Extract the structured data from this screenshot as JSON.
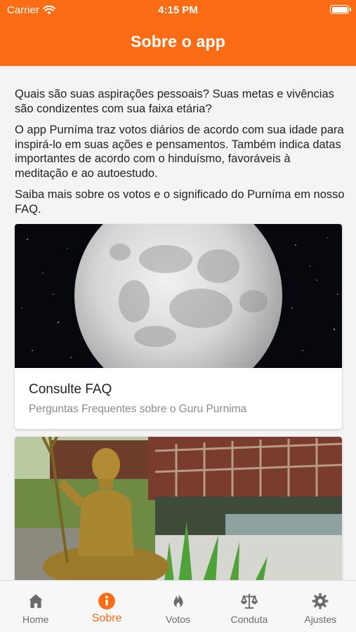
{
  "status_bar": {
    "carrier": "Carrier",
    "time": "4:15 PM"
  },
  "header": {
    "title": "Sobre o app"
  },
  "intro": {
    "p1": "Quais são suas aspirações pessoais? Suas metas e vivências são condizentes com sua faixa etária?",
    "p2": "O app Purníma traz votos diários de acordo com sua idade para inspirá-lo em suas ações e pensamentos. Também indica datas importantes de acordo com o hinduísmo, favoráveis à meditação e ao autoestudo.",
    "p3": "Saiba mais sobre os votos e o significado do Purníma em nosso FAQ."
  },
  "cards": [
    {
      "title": "Consulte FAQ",
      "subtitle": "Perguntas Frequentes sobre o Guru Purnima",
      "image": "full-moon-image"
    },
    {
      "image": "shiva-statue-garden-image"
    }
  ],
  "tabs": [
    {
      "label": "Home",
      "icon": "home-icon",
      "active": false
    },
    {
      "label": "Sobre",
      "icon": "info-icon",
      "active": true
    },
    {
      "label": "Votos",
      "icon": "flame-icon",
      "active": false
    },
    {
      "label": "Conduta",
      "icon": "scales-icon",
      "active": false
    },
    {
      "label": "Ajustes",
      "icon": "gear-icon",
      "active": false
    }
  ],
  "colors": {
    "accent": "#fb6c15",
    "tab_inactive": "#6b6b6b"
  }
}
